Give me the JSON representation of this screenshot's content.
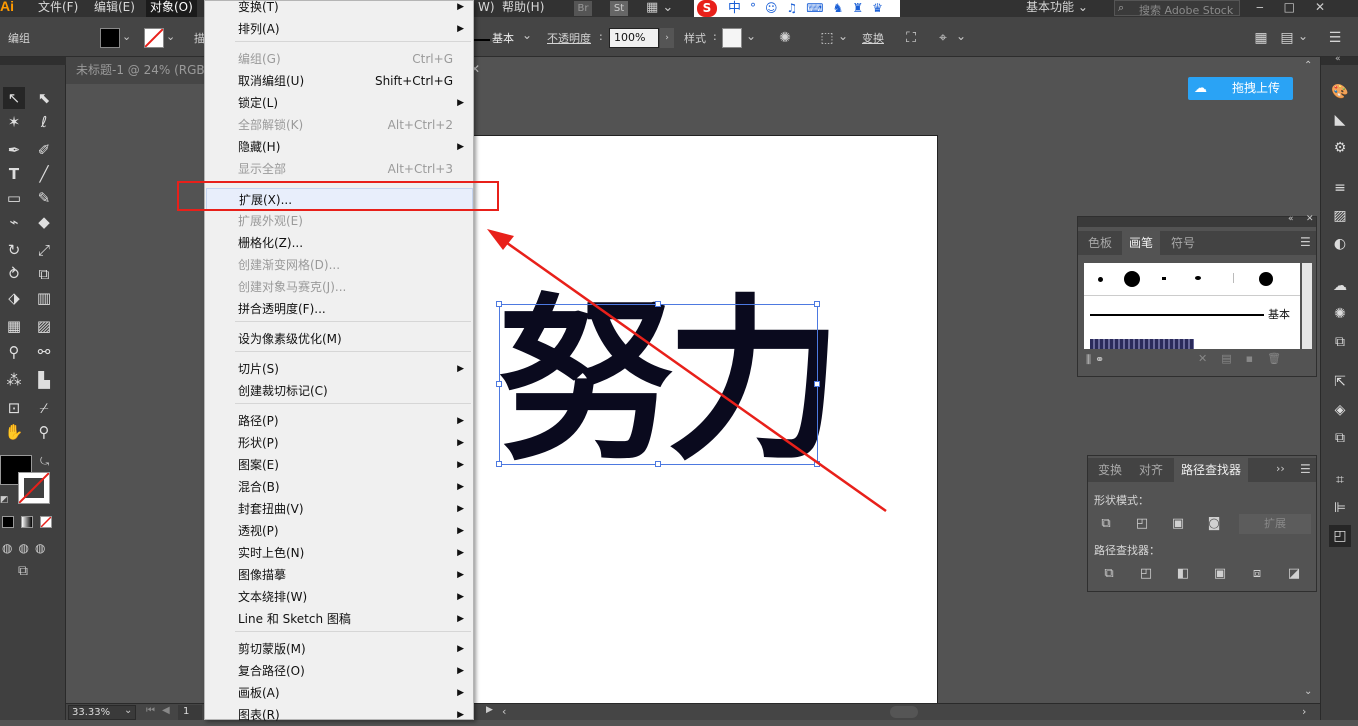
{
  "app_logo": "Ai",
  "menubar": {
    "items": [
      "文件(F)",
      "编辑(E)",
      "对象(O)",
      "W)",
      "帮助(H)"
    ],
    "workspace": "基本功能",
    "search_placeholder": "搜索 Adobe Stock",
    "br_label": "Br",
    "st_label": "St",
    "ime_label": "中"
  },
  "controlbar": {
    "group_label": "编组",
    "stroke_label": "描",
    "stroke_style": "基本",
    "opacity_label": "不透明度",
    "opacity_value": "100%",
    "style_label": "样式",
    "transform_label": "变换"
  },
  "doc_tab": {
    "title": "未标题-1 @ 24% (RGB"
  },
  "object_menu": {
    "items": [
      {
        "label": "变换(T)",
        "shortcut": "",
        "submenu": true,
        "disabled": false
      },
      {
        "label": "排列(A)",
        "shortcut": "",
        "submenu": true,
        "disabled": false
      },
      {
        "label": "编组(G)",
        "shortcut": "Ctrl+G",
        "submenu": false,
        "disabled": true
      },
      {
        "label": "取消编组(U)",
        "shortcut": "Shift+Ctrl+G",
        "submenu": false,
        "disabled": false
      },
      {
        "label": "锁定(L)",
        "shortcut": "",
        "submenu": true,
        "disabled": false
      },
      {
        "label": "全部解锁(K)",
        "shortcut": "Alt+Ctrl+2",
        "submenu": false,
        "disabled": true
      },
      {
        "label": "隐藏(H)",
        "shortcut": "",
        "submenu": true,
        "disabled": false
      },
      {
        "label": "显示全部",
        "shortcut": "Alt+Ctrl+3",
        "submenu": false,
        "disabled": true
      },
      {
        "label": "扩展(X)...",
        "shortcut": "",
        "submenu": false,
        "disabled": false
      },
      {
        "label": "扩展外观(E)",
        "shortcut": "",
        "submenu": false,
        "disabled": true
      },
      {
        "label": "栅格化(Z)...",
        "shortcut": "",
        "submenu": false,
        "disabled": false
      },
      {
        "label": "创建渐变网格(D)...",
        "shortcut": "",
        "submenu": false,
        "disabled": true
      },
      {
        "label": "创建对象马赛克(J)...",
        "shortcut": "",
        "submenu": false,
        "disabled": true
      },
      {
        "label": "拼合透明度(F)...",
        "shortcut": "",
        "submenu": false,
        "disabled": false
      },
      {
        "label": "设为像素级优化(M)",
        "shortcut": "",
        "submenu": false,
        "disabled": false
      },
      {
        "label": "切片(S)",
        "shortcut": "",
        "submenu": true,
        "disabled": false
      },
      {
        "label": "创建裁切标记(C)",
        "shortcut": "",
        "submenu": false,
        "disabled": false
      },
      {
        "label": "路径(P)",
        "shortcut": "",
        "submenu": true,
        "disabled": false
      },
      {
        "label": "形状(P)",
        "shortcut": "",
        "submenu": true,
        "disabled": false
      },
      {
        "label": "图案(E)",
        "shortcut": "",
        "submenu": true,
        "disabled": false
      },
      {
        "label": "混合(B)",
        "shortcut": "",
        "submenu": true,
        "disabled": false
      },
      {
        "label": "封套扭曲(V)",
        "shortcut": "",
        "submenu": true,
        "disabled": false
      },
      {
        "label": "透视(P)",
        "shortcut": "",
        "submenu": true,
        "disabled": false
      },
      {
        "label": "实时上色(N)",
        "shortcut": "",
        "submenu": true,
        "disabled": false
      },
      {
        "label": "图像描摹",
        "shortcut": "",
        "submenu": true,
        "disabled": false
      },
      {
        "label": "文本绕排(W)",
        "shortcut": "",
        "submenu": true,
        "disabled": false
      },
      {
        "label": "Line 和 Sketch 图稿",
        "shortcut": "",
        "submenu": true,
        "disabled": false
      },
      {
        "label": "剪切蒙版(M)",
        "shortcut": "",
        "submenu": true,
        "disabled": false
      },
      {
        "label": "复合路径(O)",
        "shortcut": "",
        "submenu": true,
        "disabled": false
      },
      {
        "label": "画板(A)",
        "shortcut": "",
        "submenu": true,
        "disabled": false
      },
      {
        "label": "图表(R)",
        "shortcut": "",
        "submenu": true,
        "disabled": false
      }
    ]
  },
  "artwork_text": "努力",
  "upload_button": "拖拽上传",
  "brush_panel": {
    "tabs": [
      "色板",
      "画笔",
      "符号"
    ],
    "active_tab": "画笔",
    "basic_label": "基本"
  },
  "pathfinder_panel": {
    "tabs": [
      "变换",
      "对齐",
      "路径查找器"
    ],
    "active_tab": "路径查找器",
    "shape_modes_label": "形状模式：",
    "expand_label": "扩展",
    "pathfinders_label": "路径查找器："
  },
  "statusbar": {
    "zoom": "33.33%",
    "artboard_number": "1"
  },
  "colors": {
    "annotation_red": "#e8201a",
    "selection_blue": "#4d79e0",
    "upload_blue": "#2aa3f5",
    "ai_orange": "#ff9a00"
  }
}
